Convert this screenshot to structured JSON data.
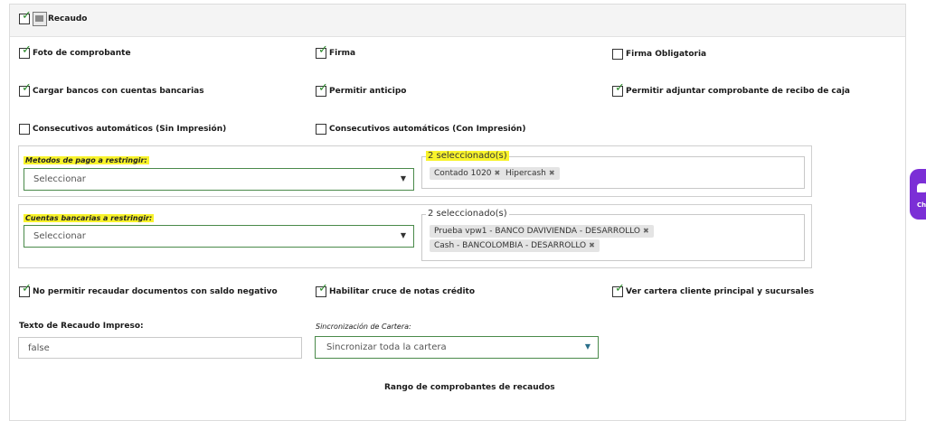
{
  "header": {
    "title": "Recaudo",
    "enabled": true
  },
  "options": [
    {
      "label": "Foto de comprobante",
      "checked": true
    },
    {
      "label": "Firma",
      "checked": true
    },
    {
      "label": "Firma Obligatoria",
      "checked": false
    },
    {
      "label": "Cargar bancos con cuentas bancarias",
      "checked": true
    },
    {
      "label": "Permitir anticipo",
      "checked": true
    },
    {
      "label": "Permitir adjuntar comprobante de recibo de caja",
      "checked": true
    },
    {
      "label": "Consecutivos automáticos (Sin Impresión)",
      "checked": false
    },
    {
      "label": "Consecutivos automáticos (Con Impresión)",
      "checked": false
    }
  ],
  "payment_methods": {
    "label": "Metodos de pago a restringir:",
    "select_placeholder": "Seleccionar",
    "selected_legend": "2 seleccionado(s)",
    "chips": [
      "Contado 1020",
      "Hipercash"
    ]
  },
  "bank_accounts": {
    "label": "Cuentas bancarias a restringir:",
    "select_placeholder": "Seleccionar",
    "selected_legend": "2 seleccionado(s)",
    "chips": [
      "Prueba vpw1 - BANCO DAVIVIENDA - DESARROLLO",
      "Cash - BANCOLOMBIA - DESARROLLO"
    ]
  },
  "options2": [
    {
      "label": "No permitir recaudar documentos con saldo negativo",
      "checked": true
    },
    {
      "label": "Habilitar cruce de notas crédito",
      "checked": true
    },
    {
      "label": "Ver cartera cliente principal y sucursales",
      "checked": true
    }
  ],
  "printed_text": {
    "label": "Texto de Recaudo Impreso:",
    "value": "false"
  },
  "sync": {
    "label": "Sincronización de Cartera:",
    "value": "Sincronizar toda la cartera"
  },
  "range_title": "Rango de comprobantes de recaudos",
  "side_tab": {
    "label": "Cha"
  },
  "colors": {
    "accent": "#2e8b2e",
    "highlight": "#f8f32b",
    "side_tab": "#7b2fd6"
  }
}
